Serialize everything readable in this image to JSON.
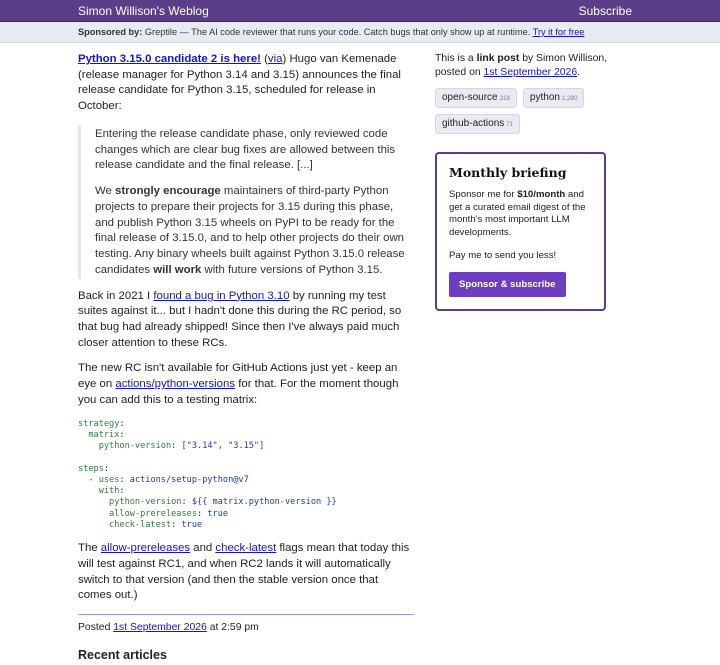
{
  "header": {
    "site_title": "Simon Willison's Weblog",
    "subscribe_label": "Subscribe"
  },
  "sponsor_bar": {
    "label": "Sponsored by:",
    "text": "Greptile — The AI code reviewer that runs your code. Catch bugs that only show up at runtime.",
    "link": "Try it for free"
  },
  "entry": {
    "title_link": "Python 3.15.0 candidate 2 is here!",
    "via_open": " (",
    "via_link": "via",
    "intro_rest": ") Hugo van Kemenade (release manager for Python 3.14 and 3.15) announces the final release candidate for Python 3.15, scheduled for release in October:",
    "quote_p1": "Entering the release candidate phase, only reviewed code changes which are clear bug fixes are allowed between this release candidate and the final release. [...]",
    "quote_p2_a": "We ",
    "quote_p2_b": "strongly encourage",
    "quote_p2_c": " maintainers of third-party Python projects to prepare their projects for 3.15 during this phase, and publish Python 3.15 wheels on PyPI to be ready for the final release of 3.15.0, and to help other projects do their own testing. Any binary wheels built against Python 3.15.0 release candidates ",
    "quote_p2_d": "will work",
    "quote_p2_e": " with future versions of Python 3.15.",
    "p2_a": "Back in 2021 I ",
    "p2_link": "found a bug in Python 3.10",
    "p2_b": " by running my test suites against it... but I hadn't done this during the RC period, so that bug had already shipped! Since then I've always paid much closer attention to these RCs.",
    "p3_a": "The new RC isn't available for GitHub Actions just yet - keep an eye on ",
    "p3_link": "actions/python-versions",
    "p3_b": " for that. For the moment though you can add this to a testing matrix:",
    "code": {
      "l1k": "strategy",
      "l1c": ":",
      "l2k": "  matrix",
      "l2c": ":",
      "l3k": "    python-version",
      "l3c": ": ",
      "l3v": "[\"3.14\", \"3.15\"]",
      "l5k": "steps",
      "l5c": ":",
      "l6a": "  - ",
      "l6k": "uses",
      "l6c": ": ",
      "l6v": "actions/setup-python@v7",
      "l7k": "    with",
      "l7c": ":",
      "l8k": "      python-version",
      "l8c": ": ",
      "l8v": "${{ matrix.python-version }}",
      "l9k": "      allow-prereleases",
      "l9c": ": ",
      "l9v": "true",
      "l10k": "      check-latest",
      "l10c": ": ",
      "l10v": "true"
    },
    "p4_a": "The ",
    "p4_link1": "allow-prereleases",
    "p4_b": " and ",
    "p4_link2": "check-latest",
    "p4_c": " flags mean that today this will test against RC1, and when RC2 lands it will automatically switch to that version (and then the stable version once that comes out.)",
    "posted_label": "Posted ",
    "posted_date": "1st September 2026",
    "posted_time": " at 2:59 pm",
    "recent_heading": "Recent articles"
  },
  "sidebar": {
    "meta_a": "This is a ",
    "meta_b": "link post",
    "meta_c": " by Simon Willison, posted on ",
    "meta_date": "1st September 2026",
    "meta_d": ".",
    "tags": [
      {
        "name": "open-source",
        "count": "318"
      },
      {
        "name": "python",
        "count": "1,280"
      },
      {
        "name": "github-actions",
        "count": "71"
      }
    ],
    "briefing": {
      "title": "Monthly briefing",
      "text_a": "Sponsor me for ",
      "text_b": "$10/month",
      "text_c": " and get a curated email digest of the month's most important LLM developments.",
      "text2": "Pay me to send you less!",
      "button": "Sponsor & subscribe"
    }
  },
  "colors": {
    "header_bg": "#5b3e88",
    "link": "#1515c8",
    "button_bg": "#6d3fc0",
    "sponsor_bg": "#e8ebf1"
  }
}
